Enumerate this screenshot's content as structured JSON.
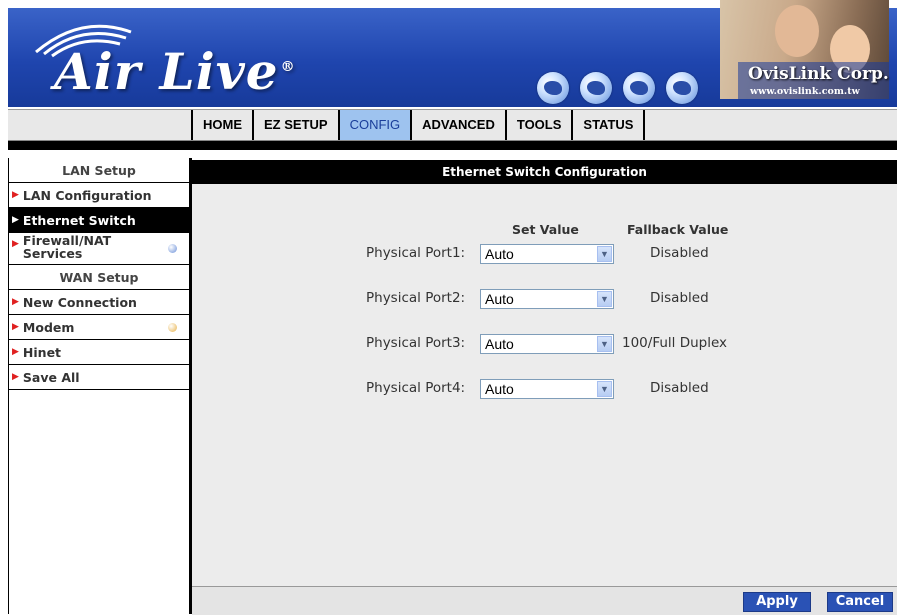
{
  "banner": {
    "logo": "Air Live",
    "logo_reg": "®",
    "company": "OvisLink Corp.",
    "url": "www.ovislink.com.tw",
    "icons": [
      "globe-icon",
      "globe-icon",
      "globe-icon",
      "globe-icon"
    ]
  },
  "nav": {
    "tabs": [
      "HOME",
      "EZ SETUP",
      "CONFIG",
      "ADVANCED",
      "TOOLS",
      "STATUS"
    ],
    "active": "CONFIG"
  },
  "sidebar": {
    "lan_header": "LAN Setup",
    "lan_config": "LAN Configuration",
    "ethernet_switch": "Ethernet Switch",
    "firewall_line1": "Firewall/NAT",
    "firewall_line2": "Services",
    "wan_header": "WAN Setup",
    "new_connection": "New Connection",
    "modem": "Modem",
    "hinet": "Hinet",
    "save_all": "Save All"
  },
  "main": {
    "title": "Ethernet Switch Configuration",
    "col_set_value": "Set Value",
    "col_fallback": "Fallback Value",
    "ports": [
      {
        "label": "Physical Port1:",
        "value": "Auto",
        "fallback": "Disabled"
      },
      {
        "label": "Physical Port2:",
        "value": "Auto",
        "fallback": "Disabled"
      },
      {
        "label": "Physical Port3:",
        "value": "Auto",
        "fallback": "100/Full Duplex"
      },
      {
        "label": "Physical Port4:",
        "value": "Auto",
        "fallback": "Disabled"
      }
    ]
  },
  "buttons": {
    "apply": "Apply",
    "cancel": "Cancel"
  },
  "colors": {
    "banner": "#1f45ae",
    "active_tab": "#9ec3ef",
    "button": "#2a52b5",
    "menu_arrow": "#e02020"
  }
}
